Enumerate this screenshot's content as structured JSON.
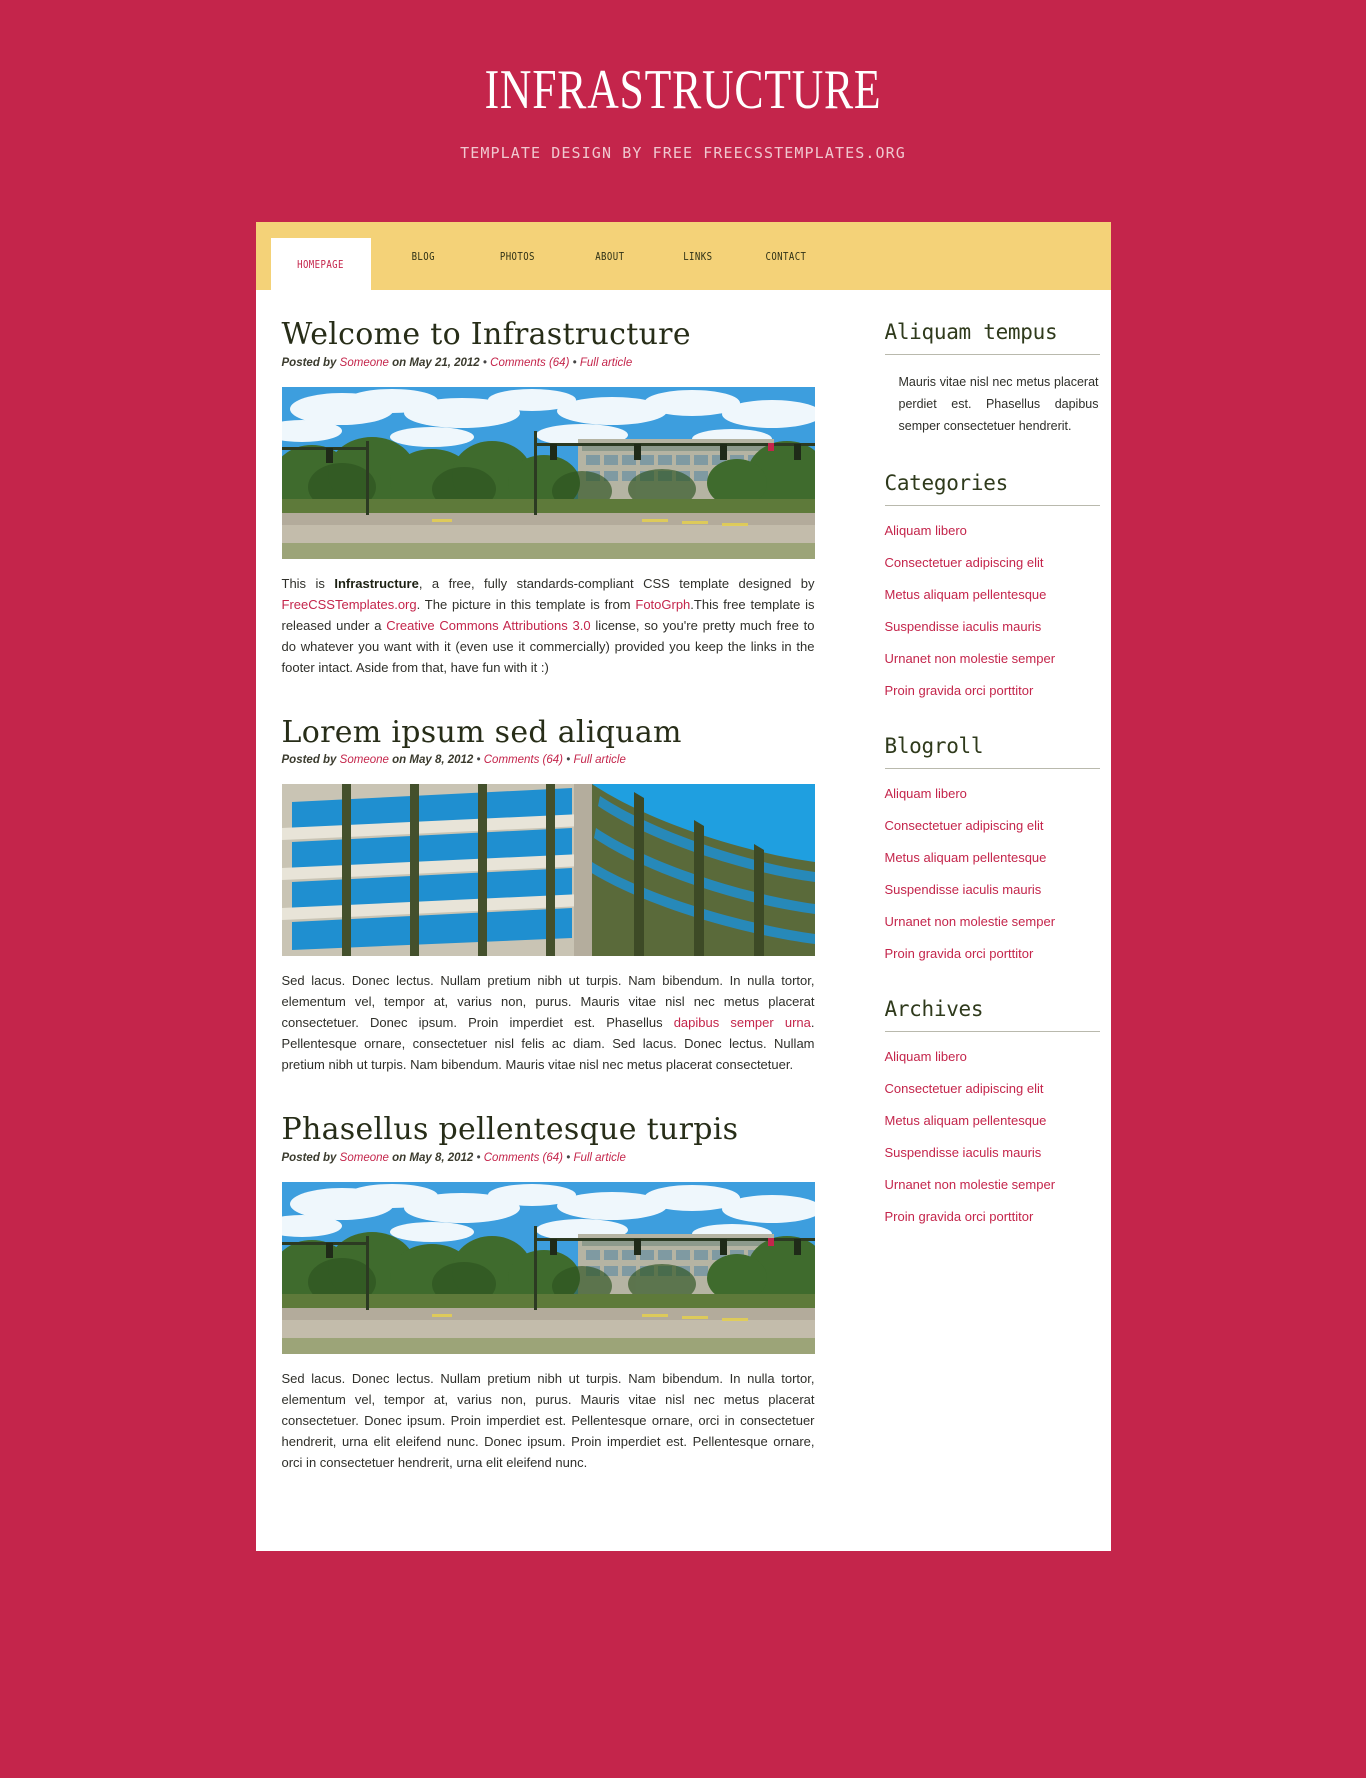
{
  "header": {
    "title": "INFRASTRUCTURE",
    "tagline": "Template Design by free freecsstemplates.org"
  },
  "colors": {
    "page_background": "#c4254b",
    "nav_background": "#f4d278",
    "accent_link": "#c4254b",
    "heading": "#272d18",
    "content_background": "#ffffff"
  },
  "nav": {
    "items": [
      {
        "label": "Homepage",
        "active": true
      },
      {
        "label": "Blog",
        "active": false
      },
      {
        "label": "Photos",
        "active": false
      },
      {
        "label": "About",
        "active": false
      },
      {
        "label": "Links",
        "active": false
      },
      {
        "label": "Contact",
        "active": false
      }
    ]
  },
  "posts": [
    {
      "title": "Welcome to Infrastructure",
      "meta": {
        "posted_by_label": "Posted by",
        "author": "Someone",
        "on_label": "on",
        "date": "May 21, 2012",
        "comments": "Comments (64)",
        "full_article": "Full article",
        "separator": "•"
      },
      "image_alt": "office-building-street-photo",
      "body_parts": [
        {
          "text": "This is ",
          "style": "normal"
        },
        {
          "text": "Infrastructure",
          "style": "bold"
        },
        {
          "text": ", a free, fully standards-compliant CSS template designed by ",
          "style": "normal"
        },
        {
          "text": "FreeCSSTemplates.org",
          "style": "link"
        },
        {
          "text": ". The picture in this template is from ",
          "style": "normal"
        },
        {
          "text": "FotoGrph",
          "style": "link"
        },
        {
          "text": ".This free template is released under a ",
          "style": "normal"
        },
        {
          "text": "Creative Commons Attributions 3.0",
          "style": "link"
        },
        {
          "text": " license, so you're pretty much free to do whatever you want with it (even use it commercially) provided you keep the links in the footer intact. Aside from that, have fun with it :)",
          "style": "normal"
        }
      ]
    },
    {
      "title": "Lorem ipsum sed aliquam",
      "meta": {
        "posted_by_label": "Posted by",
        "author": "Someone",
        "on_label": "on",
        "date": "May 8, 2012",
        "comments": "Comments (64)",
        "full_article": "Full article",
        "separator": "•"
      },
      "image_alt": "curved-glass-facade-building-photo",
      "body_parts": [
        {
          "text": "Sed lacus. Donec lectus. Nullam pretium nibh ut turpis. Nam bibendum. In nulla tortor, elementum vel, tempor at, varius non, purus. Mauris vitae nisl nec metus placerat consectetuer. Donec ipsum. Proin imperdiet est. Phasellus ",
          "style": "normal"
        },
        {
          "text": "dapibus semper urna",
          "style": "link"
        },
        {
          "text": ". Pellentesque ornare, consectetuer nisl felis ac diam. Sed lacus. Donec lectus. Nullam pretium nibh ut turpis. Nam bibendum. Mauris vitae nisl nec metus placerat consectetuer.",
          "style": "normal"
        }
      ]
    },
    {
      "title": "Phasellus pellentesque turpis",
      "meta": {
        "posted_by_label": "Posted by",
        "author": "Someone",
        "on_label": "on",
        "date": "May 8, 2012",
        "comments": "Comments (64)",
        "full_article": "Full article",
        "separator": "•"
      },
      "image_alt": "office-building-street-photo",
      "body_parts": [
        {
          "text": "Sed lacus. Donec lectus. Nullam pretium nibh ut turpis. Nam bibendum. In nulla tortor, elementum vel, tempor at, varius non, purus. Mauris vitae nisl nec metus placerat consectetuer. Donec ipsum. Proin imperdiet est. Pellentesque ornare, orci in consectetuer hendrerit, urna elit eleifend nunc. Donec ipsum. Proin imperdiet est. Pellentesque ornare, orci in consectetuer hendrerit, urna elit eleifend nunc.",
          "style": "normal"
        }
      ]
    }
  ],
  "sidebar": {
    "blocks": [
      {
        "title": "Aliquam tempus",
        "type": "text",
        "text": "Mauris vitae nisl nec metus placerat perdiet est. Phasellus dapibus semper consectetuer hendrerit."
      },
      {
        "title": "Categories",
        "type": "list",
        "links": [
          "Aliquam libero",
          "Consectetuer adipiscing elit",
          "Metus aliquam pellentesque",
          "Suspendisse iaculis mauris",
          "Urnanet non molestie semper",
          "Proin gravida orci porttitor"
        ]
      },
      {
        "title": "Blogroll",
        "type": "list",
        "links": [
          "Aliquam libero",
          "Consectetuer adipiscing elit",
          "Metus aliquam pellentesque",
          "Suspendisse iaculis mauris",
          "Urnanet non molestie semper",
          "Proin gravida orci porttitor"
        ]
      },
      {
        "title": "Archives",
        "type": "list",
        "links": [
          "Aliquam libero",
          "Consectetuer adipiscing elit",
          "Metus aliquam pellentesque",
          "Suspendisse iaculis mauris",
          "Urnanet non molestie semper",
          "Proin gravida orci porttitor"
        ]
      }
    ]
  }
}
